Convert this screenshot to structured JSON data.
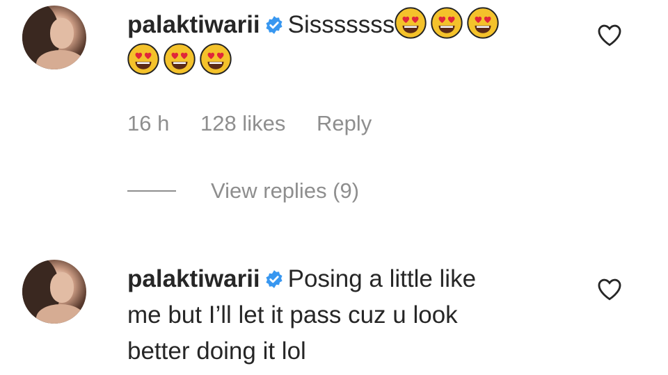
{
  "comments": [
    {
      "username": "palaktiwarii",
      "verified": true,
      "text": "Sisssssss",
      "emoji_count": 6,
      "emoji_icon": "heart-eyes-emoji",
      "time": "16 h",
      "likes": "128 likes",
      "reply_label": "Reply",
      "view_replies": "View replies (9)"
    },
    {
      "username": "palaktiwarii",
      "verified": true,
      "line1": "Posing a little like",
      "line2": "me but I’ll let it pass cuz u look",
      "line3": "better doing it lol"
    }
  ],
  "icons": {
    "verified": "verified-badge-icon",
    "like": "heart-outline-icon"
  },
  "colors": {
    "verified_blue": "#3897f0",
    "secondary_text": "#8e8e8e",
    "primary_text": "#262626"
  }
}
